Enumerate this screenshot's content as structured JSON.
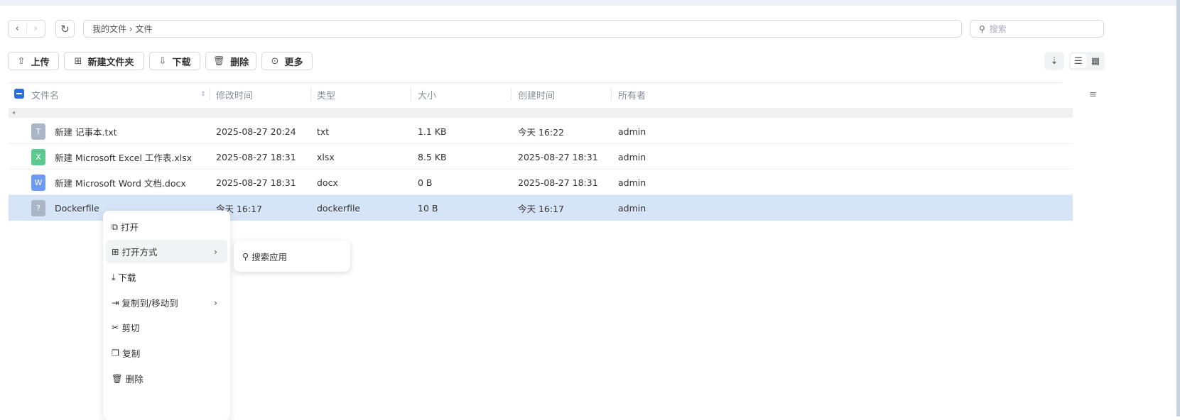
{
  "breadcrumb": {
    "root": "我的文件",
    "sep": "›",
    "current": "文件"
  },
  "search": {
    "placeholder": "搜索"
  },
  "toolbar": {
    "upload": "上传",
    "new_folder": "新建文件夹",
    "download": "下载",
    "delete": "删除",
    "more": "更多"
  },
  "columns": {
    "name": "文件名",
    "modified": "修改时间",
    "type": "类型",
    "size": "大小",
    "created": "创建时间",
    "owner": "所有者"
  },
  "files": [
    {
      "name": "新建 记事本.txt",
      "icon": "T",
      "color": "#aab6c8",
      "modified": "2025-08-27 20:24",
      "type": "txt",
      "size": "1.1 KB",
      "created": "今天 16:22",
      "owner": "admin"
    },
    {
      "name": "新建 Microsoft Excel 工作表.xlsx",
      "icon": "X",
      "color": "#5cc98f",
      "modified": "2025-08-27 18:31",
      "type": "xlsx",
      "size": "8.5 KB",
      "created": "2025-08-27 18:31",
      "owner": "admin"
    },
    {
      "name": "新建 Microsoft Word 文档.docx",
      "icon": "W",
      "color": "#6d9bf0",
      "modified": "2025-08-27 18:31",
      "type": "docx",
      "size": "0 B",
      "created": "2025-08-27 18:31",
      "owner": "admin"
    },
    {
      "name": "Dockerfile",
      "icon": "?",
      "color": "#aab6c8",
      "modified": "今天 16:17",
      "type": "dockerfile",
      "size": "10 B",
      "created": "今天 16:17",
      "owner": "admin"
    }
  ],
  "context_menu": {
    "open": "打开",
    "open_with": "打开方式",
    "download": "下载",
    "copy_move": "复制到/移动到",
    "cut": "剪切",
    "copy": "复制",
    "delete": "删除"
  },
  "submenu": {
    "search_apps": "搜索应用"
  }
}
